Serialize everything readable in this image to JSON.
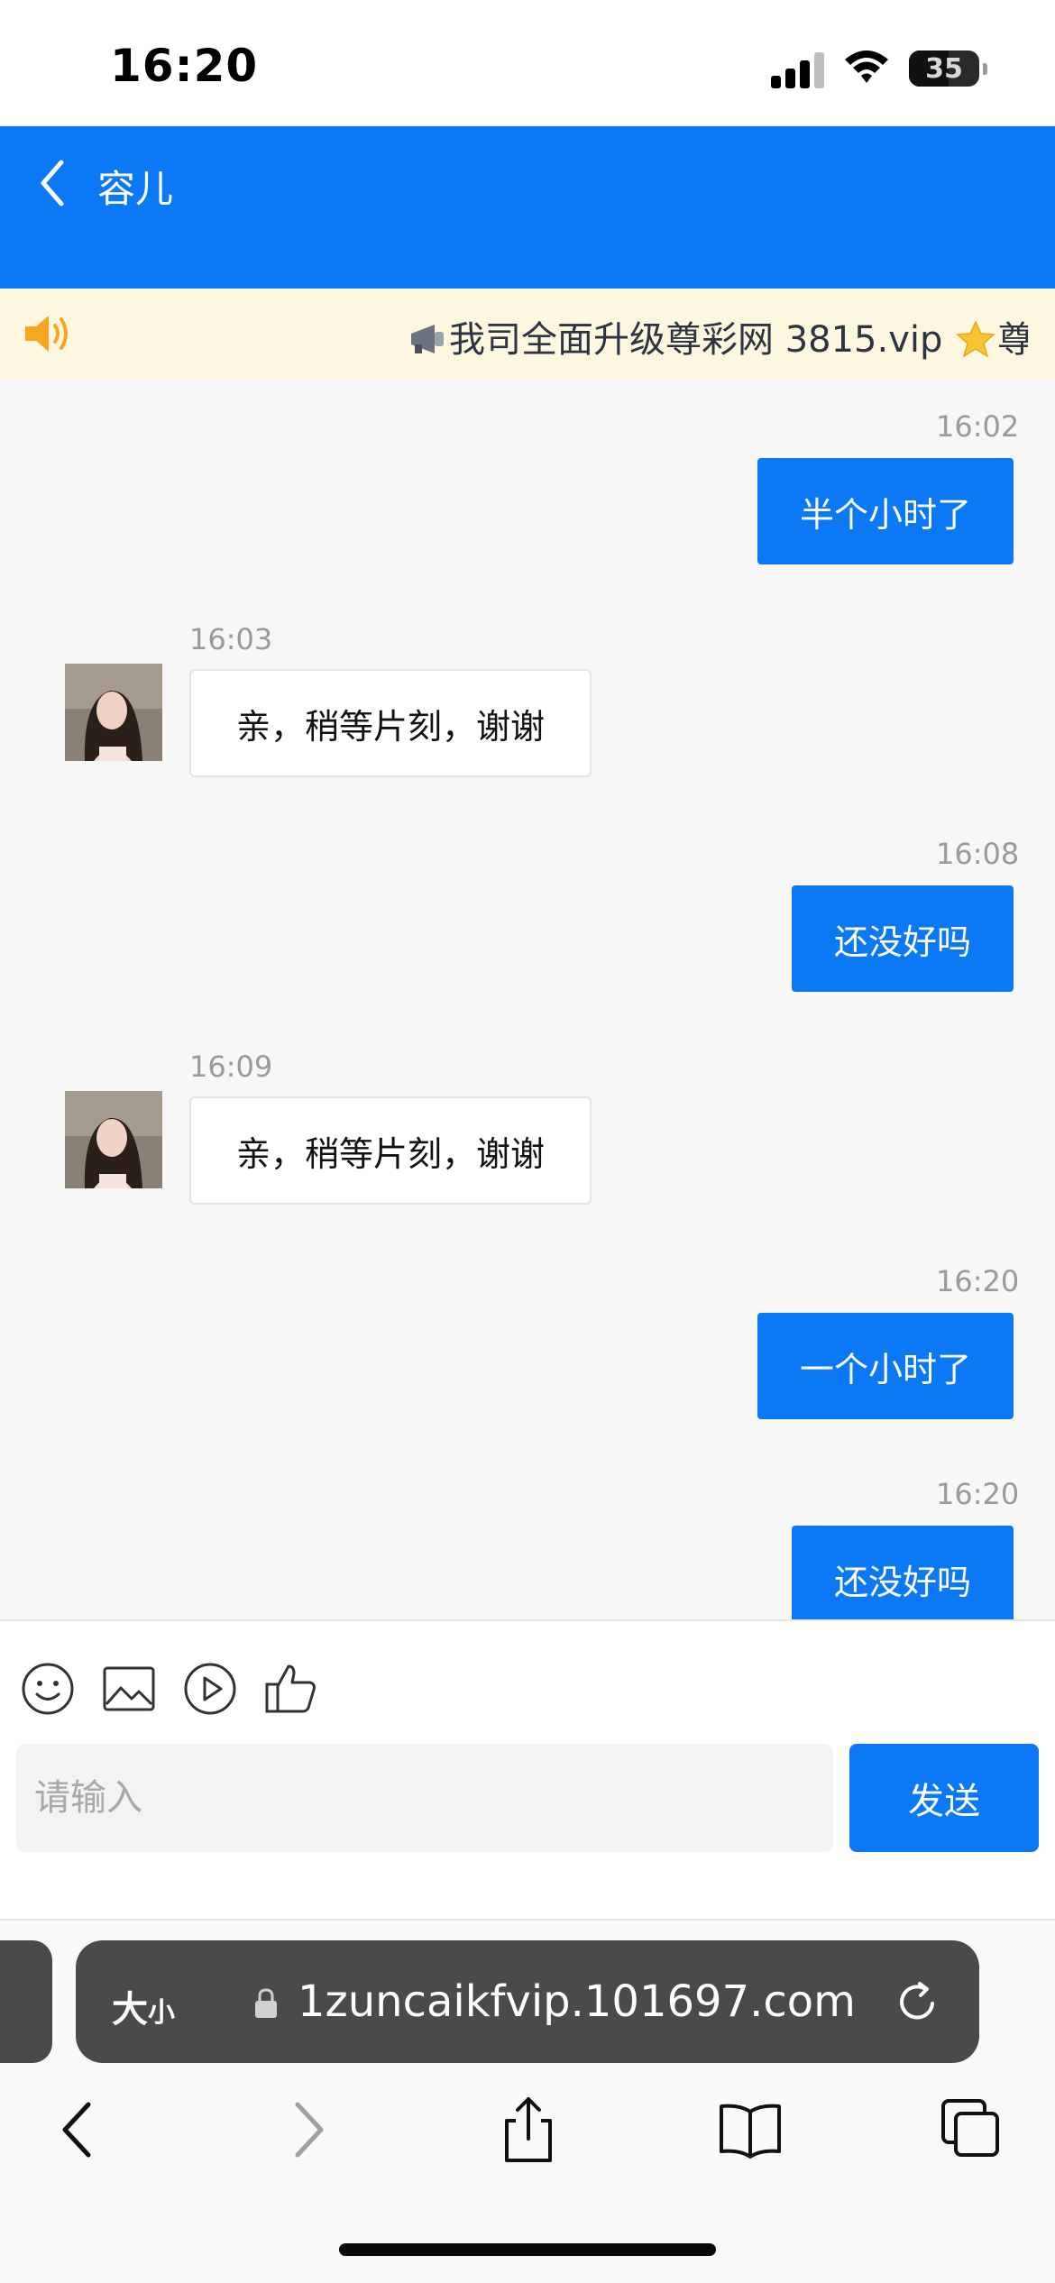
{
  "status_bar": {
    "time": "16:20",
    "battery": "35"
  },
  "header": {
    "contact_name": "容儿"
  },
  "notice": {
    "text": "我司全面升级尊彩网 3815.vip",
    "text_tail": "尊彩"
  },
  "messages": [
    {
      "direction": "out",
      "time": "16:02",
      "text": "半个小时了"
    },
    {
      "direction": "in",
      "time": "16:03",
      "text": "亲，稍等片刻，谢谢"
    },
    {
      "direction": "out",
      "time": "16:08",
      "text": "还没好吗"
    },
    {
      "direction": "in",
      "time": "16:09",
      "text": "亲，稍等片刻，谢谢"
    },
    {
      "direction": "out",
      "time": "16:20",
      "text": "一个小时了"
    },
    {
      "direction": "out",
      "time": "16:20",
      "text": "还没好吗"
    }
  ],
  "composer": {
    "tools": [
      "emoji-icon",
      "image-icon",
      "video-icon",
      "thumbs-up-icon"
    ],
    "placeholder": "请输入",
    "send_label": "发送"
  },
  "browser": {
    "text_size_label": "大",
    "text_size_small": "小",
    "url": "1zuncaikfvip.101697.com"
  },
  "colors": {
    "accent": "#0b78f5",
    "notice_bg": "#fdf7df",
    "chat_bg": "#f7f7f7"
  }
}
